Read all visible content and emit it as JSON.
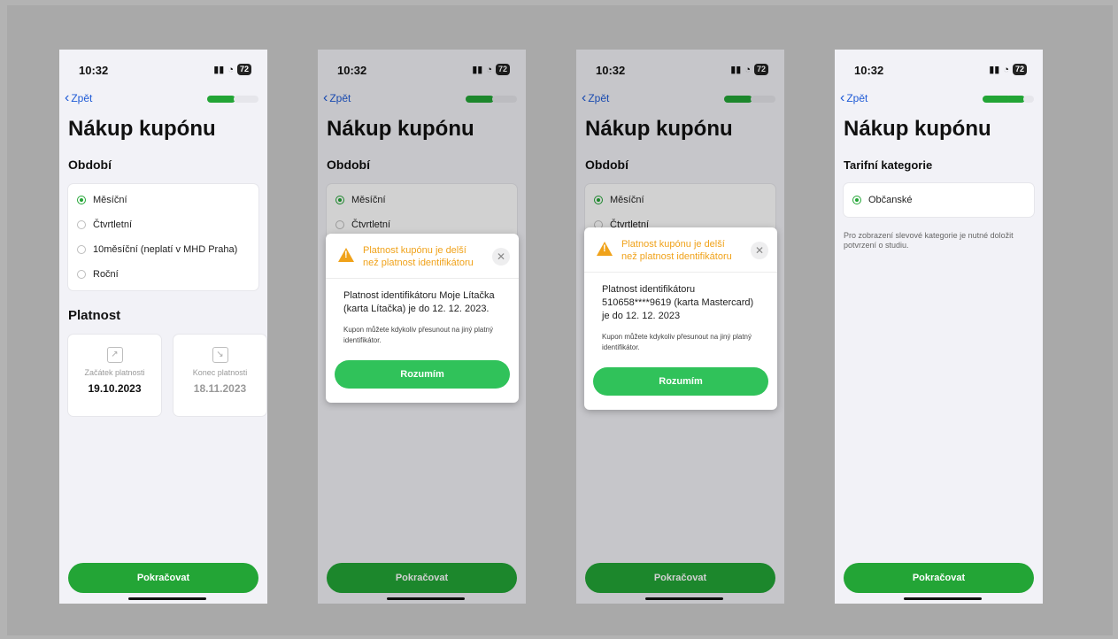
{
  "common": {
    "status_time": "10:32",
    "battery": "72",
    "back_label": "Zpět",
    "page_title": "Nákup kupónu",
    "continue_label": "Pokračovat"
  },
  "screen1": {
    "section_period": "Období",
    "period_options": [
      {
        "label": "Měsíční",
        "selected": true
      },
      {
        "label": "Čtvrtletní",
        "selected": false
      },
      {
        "label": "10měsíční (neplatí v MHD Praha)",
        "selected": false
      },
      {
        "label": "Roční",
        "selected": false
      }
    ],
    "section_validity": "Platnost",
    "start_label": "Začátek platnosti",
    "start_value": "19.10.2023",
    "end_label": "Konec platnosti",
    "end_value": "18.11.2023"
  },
  "screen2": {
    "modal_title_line1": "Platnost kupónu je delší",
    "modal_title_line2": "než platnost identifikátoru",
    "text1": "Platnost identifikátoru Moje Lítačka (karta Lítačka) je do 12. 12. 2023.",
    "text2": "Kupon můžete kdykoliv přesunout na jiný platný identifikátor.",
    "button": "Rozumím"
  },
  "screen3": {
    "modal_title_line1": "Platnost kupónu je delší",
    "modal_title_line2": "než platnost identifikátoru",
    "text1": "Platnost identifikátoru 510658****9619 (karta Mastercard) je do 12. 12. 2023",
    "text2": "Kupon můžete kdykoliv přesunout na jiný platný identifikátor.",
    "button": "Rozumím"
  },
  "screen4": {
    "section": "Tarifní kategorie",
    "option": "Občanské",
    "note": "Pro zobrazení slevové kategorie je nutné doložit potvrzení o studiu."
  },
  "colors": {
    "accent_green": "#23a536",
    "warning_orange": "#f0a21a",
    "link_blue": "#1f5bd6"
  }
}
